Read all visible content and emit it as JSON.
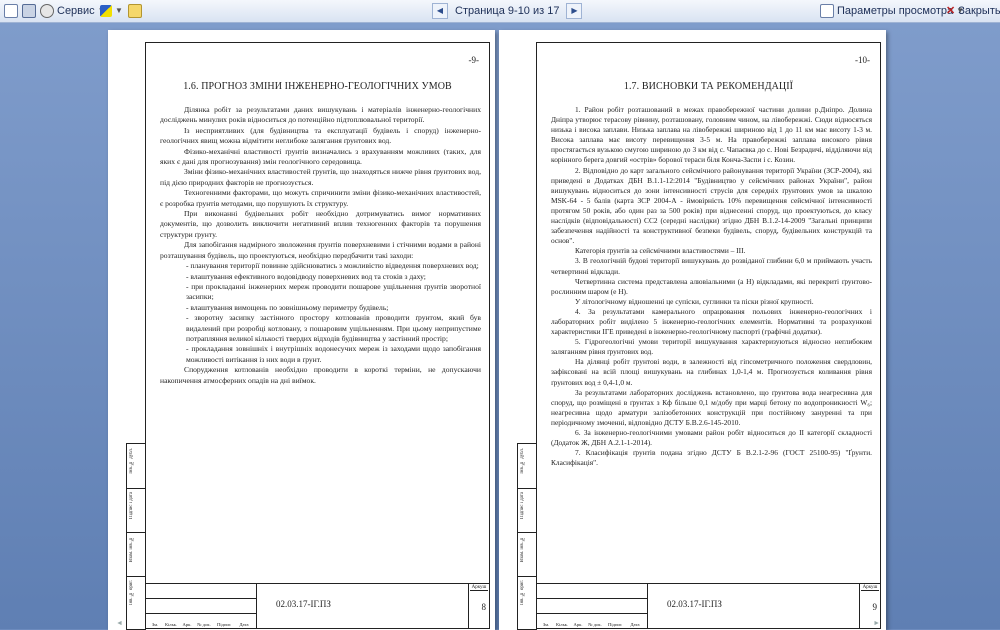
{
  "toolbar": {
    "service_label": "Сервис",
    "page_indicator": "Страница 9-10 из 17",
    "view_params_label": "Параметры просмотра",
    "close_label": "Закрыть"
  },
  "pages": [
    {
      "number": "-9-",
      "title": "1.6. ПРОГНОЗ ЗМІНИ ІНЖЕНЕРНО-ГЕОЛОГІЧНИХ УМОВ",
      "paragraphs": [
        "Ділянка робіт за результатами даних вишукувань і матеріалів інженерно-геологічних досліджень минулих років відноситься до потенційно підтоплювальної території.",
        "Із несприятливих (для будівництва та експлуатації будівель і споруд) інженерно-геологічних явищ можна відмітити неглибоке залягання ґрунтових вод.",
        "Фізико-механічні властивості ґрунтів визначались з врахуванням можливих (таких, для яких є дані для прогнозування) змін геологічного середовища.",
        "Зміни фізико-механічних властивостей ґрунтів, що знаходяться нижче рівня ґрунтових вод, під дією природних факторів не прогнозується.",
        "Техногенними факторами, що можуть спричинити зміни фізико-механічних властивостей, є розробка ґрунтів методами, що порушують їх структуру.",
        "При виконанні будівельних робіт необхідно дотримуватись вимог нормативних документів, що дозволить виключити негативний вплив техногенних факторів та порушення структури ґрунту.",
        "Для запобігання надмірного зволоження ґрунтів поверхневими і стічними водами в районі розташування будівель, що проектуються, необхідно передбачити такі заходи:"
      ],
      "bullets": [
        "- планування території повинне здійснюватись з можливістю відведення поверхневих вод;",
        "- влаштування ефективного водовідводу поверхневих вод та стоків з даху;",
        "- при прокладанні інженерних мереж проводити пошарове ущільнення ґрунтів зворотної засипки;",
        "- влаштування вимощень по зовнішньому периметру будівель;",
        "- зворотну засипку застінного простору котлованів проводити ґрунтом, який був видалений при розробці котловану, з пошаровим ущільненням. При цьому неприпустиме потрапляння великої кількості твердих відходів будівництва у застінний простір;",
        "- прокладання зовнішніх і внутрішніх водонесучих мереж із заходами щодо запобігання можливості витікання із них води в ґрунт."
      ],
      "closing": "Спорудження котлованів необхідно проводити в короткі терміни, не допускаючи накопичення атмосферних опадів на дні виїмок.",
      "stamp_code": "02.03.17-ІГ.ПЗ",
      "sheet_label": "Аркуш",
      "sheet_no": "8"
    },
    {
      "number": "-10-",
      "title": "1.7. ВИСНОВКИ ТА РЕКОМЕНДАЦІЇ",
      "paragraphs": [
        "1. Район робіт розташований в межах правобережної частини долини р.Дніпро. Долина Дніпра утворює терасову рівнину, розташовану, головним чином, на лівобережжі. Сюди відносяться низька і висока заплави. Низька заплава на лівобережжі шириною від 1 до 11 км має висоту 1-3 м. Висока заплава має висоту перевищення 3-5 м. На правобережжі заплава високого рівня простягається вузькою смугою шириною до 3 км від с. Чапаєвка до с. Нові Безрадичі, відділяючи від корінного берега довгий «острів» борової тераси біля Конча-Заспи і с. Козин.",
        "2. Відповідно до карт загального сейсмічного районування території України (ЗСР-2004), які приведені в Додатках ДБН В.1.1-12:2014 \"Будівництво у сейсмічних районах України\", район вишукувань відноситься до зони інтенсивності струсів для середніх ґрунтових умов за шкалою MSK-64 - 5 балів (карта ЗСР 2004-А - ймовірність 10% перевищення сейсмічної інтенсивності протягом 50 років, або один раз за 500 років) при віднесенні споруд, що проектуються, до класу наслідків (відповідальності) СС2 (середні наслідки) згідно ДБН В.1.2-14-2009 \"Загальні принципи забезпечення надійності та конструктивної безпеки будівель, споруд, будівельних конструкцій та основ\".",
        "Категорія ґрунтів за сейсмічними властивостями – ІІІ.",
        "3. В геологічній будові території вишукувань до розвіданої глибини 6,0 м приймають участь четвертинні відклади.",
        "Четвертинна система представлена алювіальними (a H) відкладами, які перекриті ґрунтово-рослинним шаром (e H).",
        "У літологічному відношенні це супіски, суглинки та піски різної крупності.",
        "4. За результатами камерального опрацювання польових інженерно-геологічних і лабораторних робіт виділено 5 інженерно-геологічних елементів. Нормативні та розрахункові характеристики ІГЕ приведені в інженерно-геологічному паспорті (графічні додатки).",
        "5. Гідрогеологічні умови території вишукування характеризуються відносно неглибоким заляганням рівня ґрунтових вод.",
        "На ділянці робіт ґрунтові води, в залежності від гіпсометричного положення свердловин, зафіксовані на всій площі вишукувань на глибинах 1,0-1,4 м. Прогнозується коливання рівня ґрунтових вод ± 0,4-1,0 м.",
        "За результатами лабораторних досліджень встановлено, що ґрунтова вода неагресивна для споруд, що розміщені в ґрунтах з Кф більше 0,1 м/добу при марці бетону по водопроникності W₆; неагресивна щодо арматури залізобетонних конструкцій при постійному зануренні та при періодичному змоченні, відповідно ДСТУ Б.В.2.6-145-2010.",
        "6. За інженерно-геологічними умовами район робіт відноситься до ІІ категорії складності (Додаток Ж, ДБН А.2.1-1-2014).",
        "7. Класифікація ґрунтів подана згідно ДСТУ Б В.2.1-2-96 (ГОСТ 25100-95) \"Ґрунти. Класифікація\"."
      ],
      "stamp_code": "02.03.17-ІГ.ПЗ",
      "sheet_label": "Аркуш",
      "sheet_no": "9"
    }
  ],
  "stamp_columns": [
    "Зм.",
    "Кільк.",
    "Арк.",
    "№ док.",
    "Підпис",
    "Дата"
  ],
  "side_labels": [
    "Інв. № ориг.",
    "Підпис і дата",
    "Взам. інв. №",
    "Підпис і дата",
    "Інв. № дубл."
  ]
}
